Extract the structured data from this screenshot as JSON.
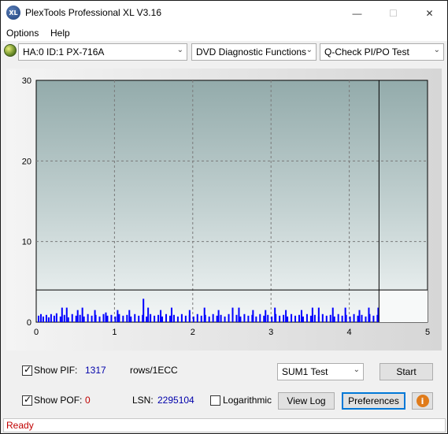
{
  "window": {
    "title": "PlexTools Professional XL V3.16",
    "icon_text": "XL",
    "min_glyph": "—",
    "max_glyph": "☐",
    "close_glyph": "✕"
  },
  "menu": {
    "items": [
      {
        "label": "Options"
      },
      {
        "label": "Help"
      }
    ]
  },
  "toolbar": {
    "drive": "HA:0 ID:1  PX-716A",
    "function": "DVD Diagnostic Functions",
    "test": "Q-Check PI/PO Test",
    "arrow": "⌄"
  },
  "chart_data": {
    "type": "bar",
    "x_ticks": [
      "0",
      "1",
      "2",
      "3",
      "4",
      "5"
    ],
    "y_ticks": [
      "0",
      "10",
      "20",
      "30"
    ],
    "xlim": [
      0,
      5
    ],
    "ylim": [
      0,
      30
    ],
    "grid": true,
    "end_marker_x": 4.38,
    "threshold_y": 4,
    "colors": {
      "bars": "#0000ff",
      "threshold": "#000000",
      "grid": "#7a7a7a"
    },
    "baseline": [
      [
        0.02,
        0.8
      ],
      [
        0.05,
        1.0
      ],
      [
        0.08,
        0.7
      ],
      [
        0.12,
        0.9
      ],
      [
        0.15,
        0.6
      ],
      [
        0.18,
        1.0
      ],
      [
        0.22,
        0.8
      ],
      [
        0.25,
        1.1
      ],
      [
        0.3,
        0.7
      ],
      [
        0.35,
        0.9
      ],
      [
        0.4,
        0.6
      ],
      [
        0.45,
        1.0
      ],
      [
        0.5,
        0.8
      ],
      [
        0.55,
        0.9
      ],
      [
        0.6,
        0.7
      ],
      [
        0.65,
        1.0
      ],
      [
        0.7,
        0.8
      ],
      [
        0.75,
        0.9
      ],
      [
        0.8,
        0.7
      ],
      [
        0.85,
        1.0
      ],
      [
        0.9,
        0.8
      ],
      [
        0.95,
        0.9
      ],
      [
        1.0,
        0.7
      ],
      [
        1.05,
        1.0
      ],
      [
        1.1,
        0.8
      ],
      [
        1.15,
        0.9
      ],
      [
        1.2,
        0.7
      ],
      [
        1.25,
        1.0
      ],
      [
        1.3,
        0.8
      ],
      [
        1.35,
        0.9
      ],
      [
        1.4,
        0.7
      ],
      [
        1.45,
        1.0
      ],
      [
        1.5,
        0.8
      ],
      [
        1.55,
        0.9
      ],
      [
        1.6,
        0.7
      ],
      [
        1.65,
        1.0
      ],
      [
        1.7,
        0.8
      ],
      [
        1.75,
        0.9
      ],
      [
        1.8,
        0.7
      ],
      [
        1.85,
        1.0
      ],
      [
        1.9,
        0.8
      ],
      [
        1.95,
        0.9
      ],
      [
        2.0,
        0.7
      ],
      [
        2.05,
        1.0
      ],
      [
        2.1,
        0.8
      ],
      [
        2.15,
        0.9
      ],
      [
        2.2,
        0.7
      ],
      [
        2.25,
        1.0
      ],
      [
        2.3,
        0.8
      ],
      [
        2.35,
        0.9
      ],
      [
        2.4,
        0.7
      ],
      [
        2.45,
        1.0
      ],
      [
        2.5,
        0.8
      ],
      [
        2.55,
        0.9
      ],
      [
        2.6,
        0.7
      ],
      [
        2.65,
        1.0
      ],
      [
        2.7,
        0.8
      ],
      [
        2.75,
        0.9
      ],
      [
        2.8,
        0.7
      ],
      [
        2.85,
        1.0
      ],
      [
        2.9,
        0.8
      ],
      [
        2.95,
        0.9
      ],
      [
        3.0,
        0.7
      ],
      [
        3.05,
        1.0
      ],
      [
        3.1,
        0.8
      ],
      [
        3.15,
        0.9
      ],
      [
        3.2,
        0.7
      ],
      [
        3.25,
        1.0
      ],
      [
        3.3,
        0.8
      ],
      [
        3.35,
        0.9
      ],
      [
        3.4,
        0.7
      ],
      [
        3.45,
        1.0
      ],
      [
        3.5,
        0.8
      ],
      [
        3.55,
        0.9
      ],
      [
        3.6,
        0.7
      ],
      [
        3.65,
        1.0
      ],
      [
        3.7,
        0.8
      ],
      [
        3.75,
        0.9
      ],
      [
        3.8,
        0.7
      ],
      [
        3.85,
        1.0
      ],
      [
        3.9,
        0.8
      ],
      [
        3.95,
        0.9
      ],
      [
        4.0,
        0.7
      ],
      [
        4.05,
        1.0
      ],
      [
        4.1,
        0.8
      ],
      [
        4.15,
        0.9
      ],
      [
        4.2,
        0.7
      ],
      [
        4.25,
        1.0
      ],
      [
        4.3,
        0.8
      ],
      [
        4.35,
        0.9
      ]
    ],
    "spikes": [
      [
        0.32,
        1.8
      ],
      [
        0.38,
        1.8
      ],
      [
        0.52,
        1.5
      ],
      [
        0.58,
        1.8
      ],
      [
        0.74,
        1.5
      ],
      [
        0.88,
        1.2
      ],
      [
        1.03,
        1.5
      ],
      [
        1.18,
        1.5
      ],
      [
        1.36,
        2.9
      ],
      [
        1.42,
        1.8
      ],
      [
        1.58,
        1.5
      ],
      [
        1.72,
        1.8
      ],
      [
        1.95,
        1.5
      ],
      [
        2.14,
        1.8
      ],
      [
        2.32,
        1.5
      ],
      [
        2.5,
        1.8
      ],
      [
        2.58,
        1.8
      ],
      [
        2.76,
        1.5
      ],
      [
        2.92,
        1.5
      ],
      [
        3.04,
        1.8
      ],
      [
        3.18,
        1.5
      ],
      [
        3.38,
        1.5
      ],
      [
        3.52,
        1.8
      ],
      [
        3.6,
        1.8
      ],
      [
        3.78,
        1.8
      ],
      [
        3.94,
        1.8
      ],
      [
        4.12,
        1.5
      ],
      [
        4.24,
        1.8
      ],
      [
        4.36,
        1.8
      ]
    ]
  },
  "controls": {
    "show_pif_label": "Show PIF:",
    "pif_value": "1317",
    "rows_label": "rows/1ECC",
    "show_pof_label": "Show POF:",
    "pof_value": "0",
    "lsn_label": "LSN:",
    "lsn_value": "2295104",
    "logarithmic_label": "Logarithmic",
    "test_select": "SUM1 Test",
    "start_label": "Start",
    "view_log_label": "View Log",
    "preferences_label": "Preferences",
    "info_glyph": "i",
    "check_pif": true,
    "check_pof": true,
    "check_log": false,
    "pof_color": "#c00000",
    "value_color": "#0000aa"
  },
  "status": {
    "text": "Ready"
  }
}
